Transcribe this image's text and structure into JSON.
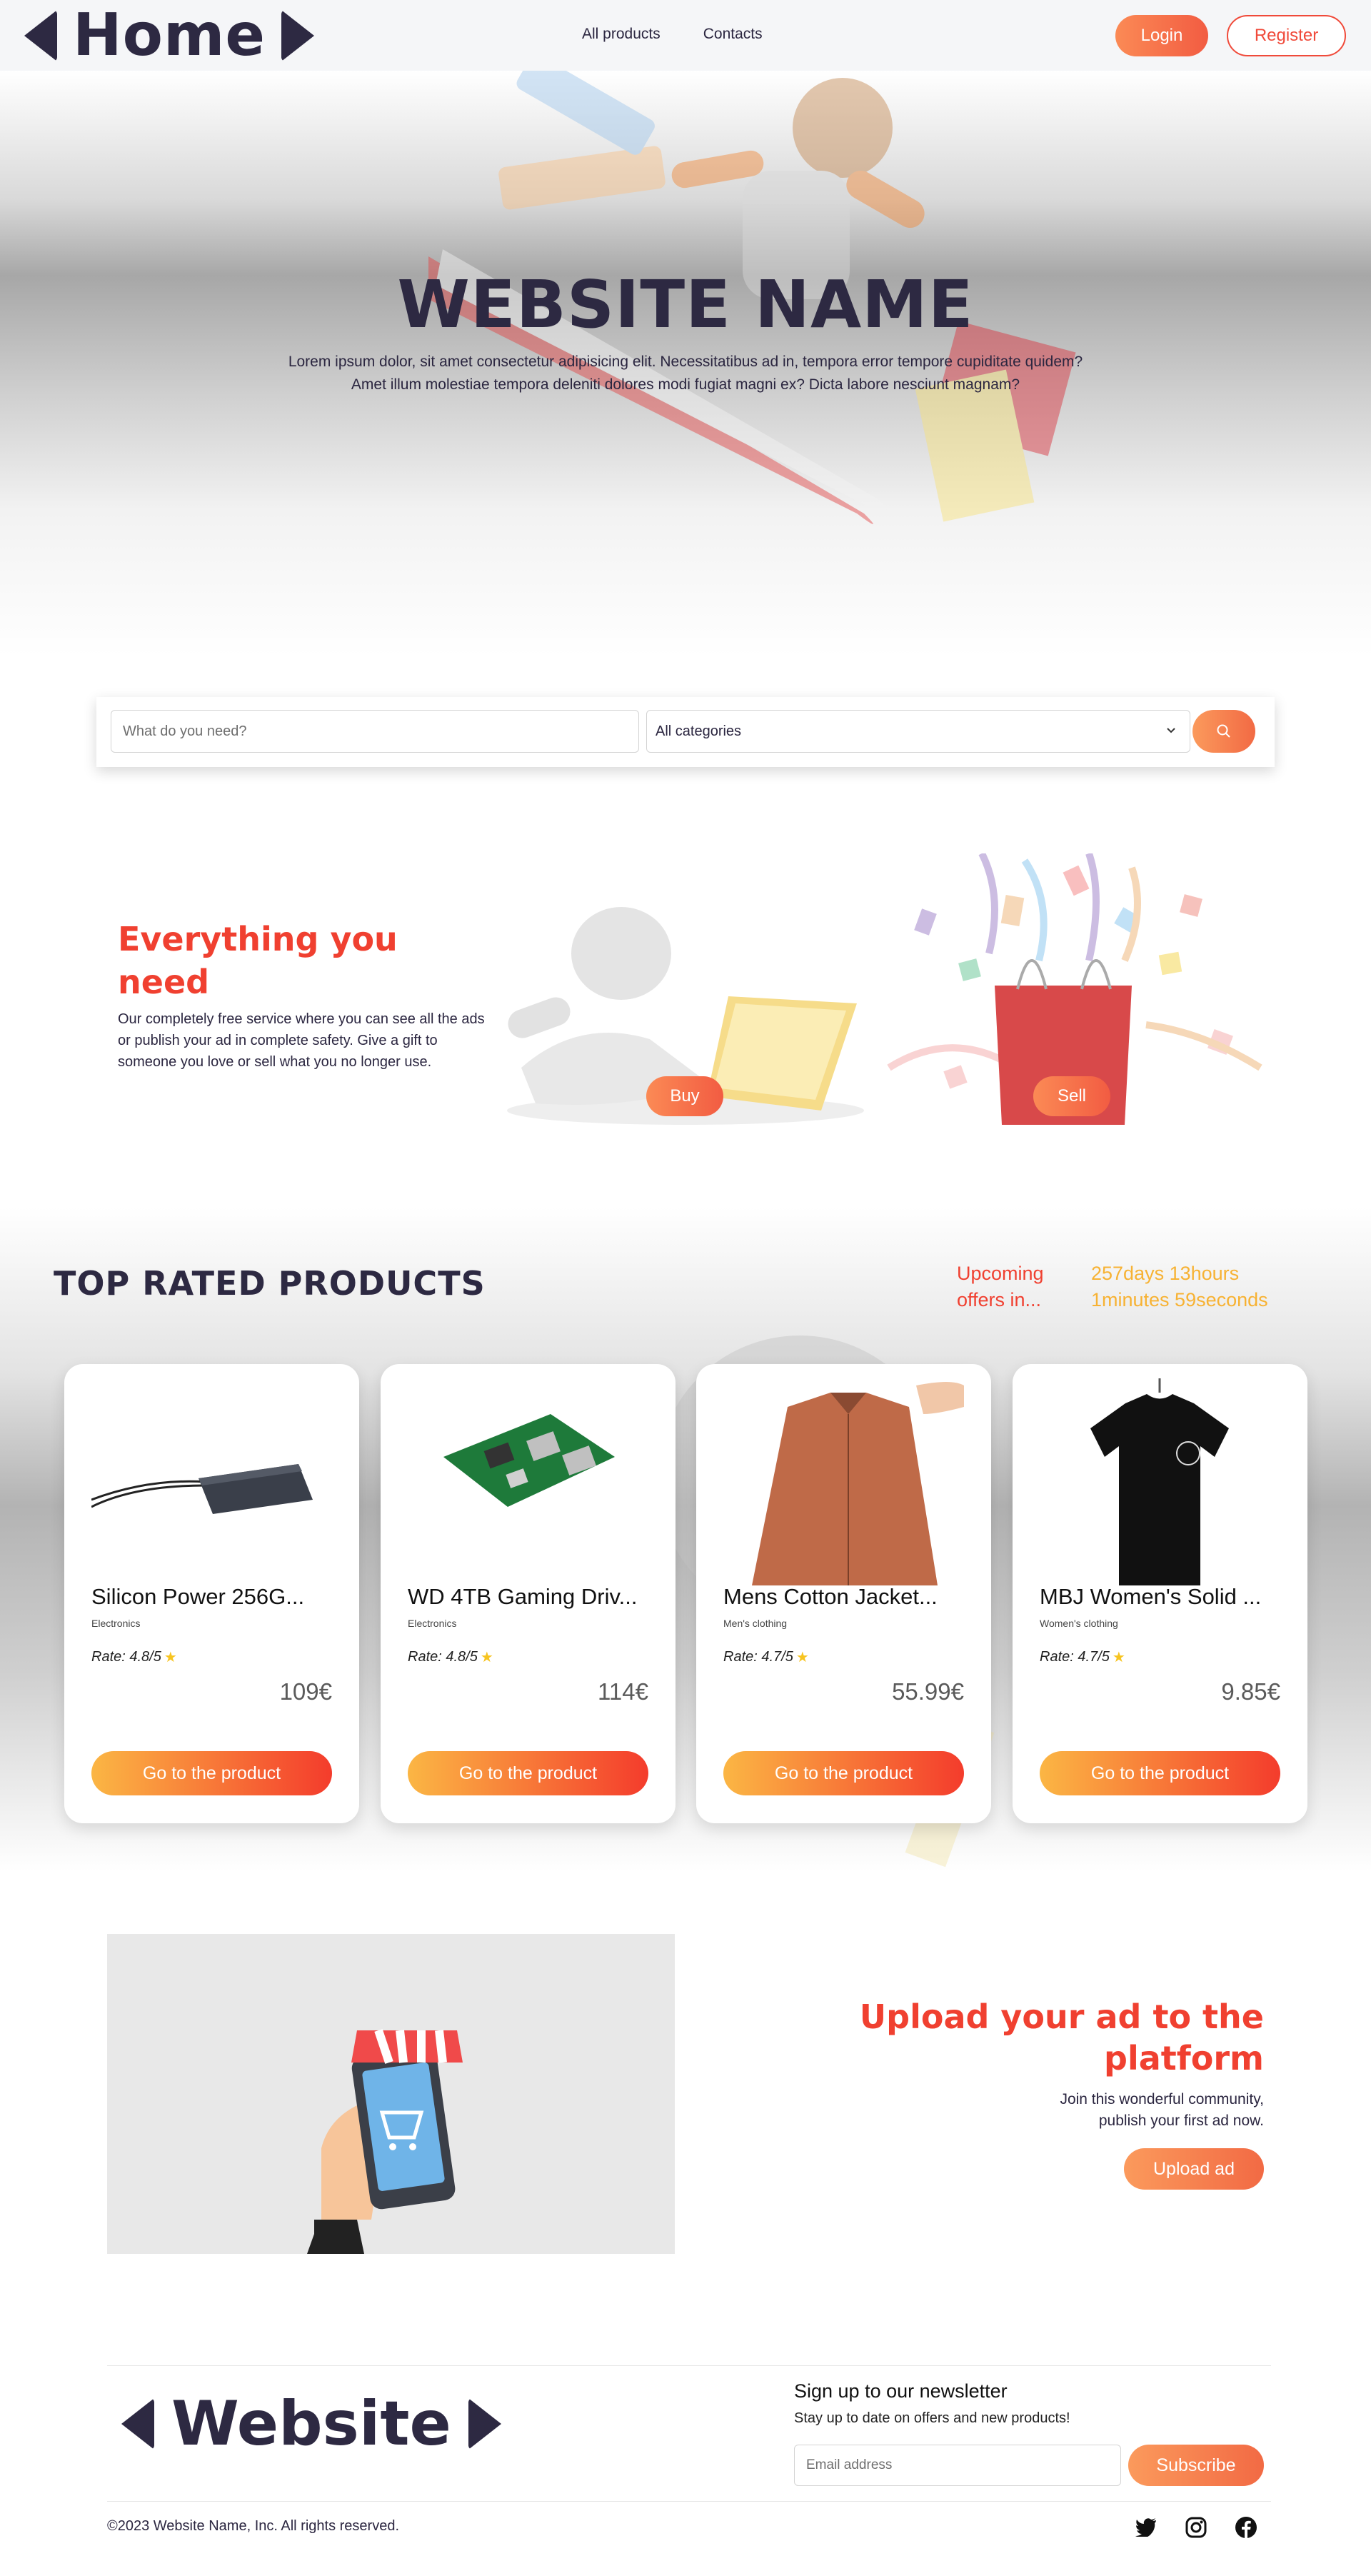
{
  "navbar": {
    "logo_text": "Home",
    "links": [
      "All products",
      "Contacts"
    ],
    "login_label": "Login",
    "register_label": "Register"
  },
  "hero": {
    "title": "WEBSITE NAME",
    "text_line1": "Lorem ipsum dolor, sit amet consectetur adipisicing elit. Necessitatibus ad in, tempora error tempore cupiditate quidem?",
    "text_line2": "Amet illum molestiae tempora deleniti dolores modi fugiat magni ex? Dicta labore nesciunt magnam?"
  },
  "search": {
    "placeholder": "What do you need?",
    "category_selected": "All categories",
    "icon": "search-icon"
  },
  "intro": {
    "title": "Everything you need",
    "text": "Our completely free service where you can see all the ads or publish your ad in complete safety. Give a gift to someone you love or sell what you no longer use.",
    "buy_label": "Buy",
    "sell_label": "Sell"
  },
  "top_rated": {
    "title": "TOP RATED PRODUCTS",
    "upcoming_label": "Upcoming offers in...",
    "countdown": "257days 13hours 1minutes 59seconds",
    "products": [
      {
        "name": "Silicon Power 256G...",
        "category": "Electronics",
        "rate": "Rate: 4.8/5",
        "price": "109€",
        "button": "Go to the product"
      },
      {
        "name": "WD 4TB Gaming Driv...",
        "category": "Electronics",
        "rate": "Rate: 4.8/5",
        "price": "114€",
        "button": "Go to the product"
      },
      {
        "name": "Mens Cotton Jacket...",
        "category": "Men's clothing",
        "rate": "Rate: 4.7/5",
        "price": "55.99€",
        "button": "Go to the product"
      },
      {
        "name": "MBJ Women's Solid ...",
        "category": "Women's clothing",
        "rate": "Rate: 4.7/5",
        "price": "9.85€",
        "button": "Go to the product"
      }
    ]
  },
  "upload": {
    "title": "Upload your ad to the platform",
    "text_line1": "Join this wonderful community,",
    "text_line2": "publish your first ad now.",
    "button": "Upload ad"
  },
  "footer": {
    "logo_text": "Website",
    "newsletter_title": "Sign up to our newsletter",
    "newsletter_sub": "Stay up to date on offers and new products!",
    "email_placeholder": "Email address",
    "subscribe_label": "Subscribe",
    "copyright": "©2023 Website Name, Inc. All rights reserved.",
    "socials": [
      "twitter-icon",
      "instagram-icon",
      "facebook-icon"
    ]
  },
  "colors": {
    "brand_dark": "#2d2942",
    "accent_red": "#f04030",
    "accent_orange": "#fb8a55",
    "accent_yellow": "#f7b233"
  }
}
